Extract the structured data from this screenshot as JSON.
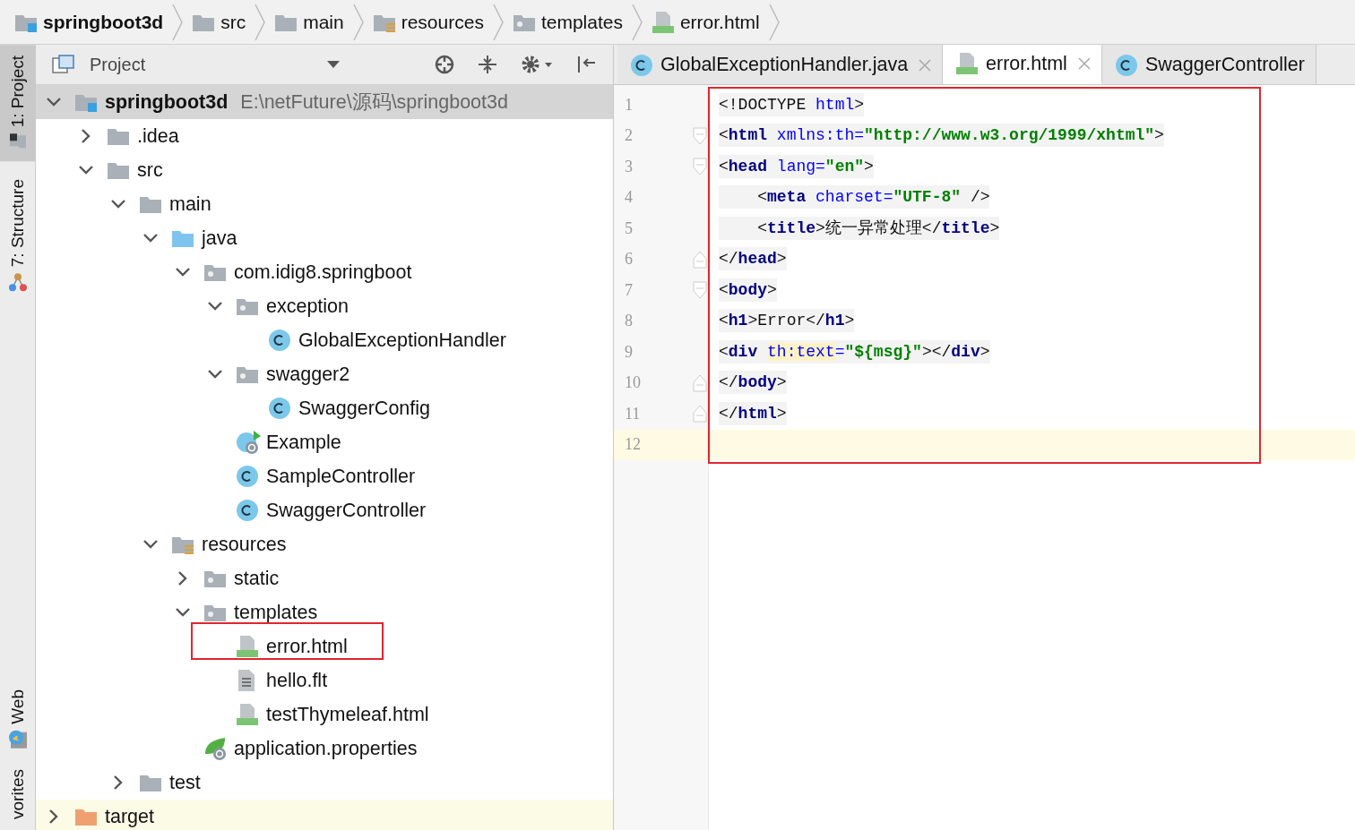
{
  "breadcrumbs": [
    {
      "label": "springboot3d",
      "kind": "module"
    },
    {
      "label": "src",
      "kind": "folder"
    },
    {
      "label": "main",
      "kind": "folder"
    },
    {
      "label": "resources",
      "kind": "resources-folder"
    },
    {
      "label": "templates",
      "kind": "resource-folder"
    },
    {
      "label": "error.html",
      "kind": "html"
    }
  ],
  "tool_strip": [
    {
      "label": "1: Project",
      "kind": "project",
      "selected": true
    },
    {
      "label": "7: Structure",
      "kind": "structure",
      "selected": false
    },
    {
      "label": "Web",
      "kind": "web",
      "selected": false
    },
    {
      "label": "vorites",
      "kind": "favorites",
      "selected": false
    }
  ],
  "project_panel": {
    "title": "Project",
    "tree": [
      {
        "label": "springboot3d",
        "path": "E:\\netFuture\\源码\\springboot3d",
        "kind": "module",
        "expanded": true,
        "selected": true,
        "highlighted": false,
        "children": [
          {
            "label": ".idea",
            "kind": "folder",
            "expanded": false,
            "selected": false,
            "highlighted": false
          },
          {
            "label": "src",
            "kind": "folder",
            "expanded": true,
            "selected": false,
            "highlighted": false,
            "children": [
              {
                "label": "main",
                "kind": "folder",
                "expanded": true,
                "selected": false,
                "highlighted": false,
                "children": [
                  {
                    "label": "java",
                    "kind": "source-folder",
                    "expanded": true,
                    "selected": false,
                    "highlighted": false,
                    "children": [
                      {
                        "label": "com.idig8.springboot",
                        "kind": "package",
                        "expanded": true,
                        "selected": false,
                        "highlighted": false,
                        "children": [
                          {
                            "label": "exception",
                            "kind": "package",
                            "expanded": true,
                            "selected": false,
                            "highlighted": false,
                            "children": [
                              {
                                "label": "GlobalExceptionHandler",
                                "kind": "class",
                                "selected": false,
                                "highlighted": false
                              }
                            ]
                          },
                          {
                            "label": "swagger2",
                            "kind": "package",
                            "expanded": true,
                            "selected": false,
                            "highlighted": false,
                            "children": [
                              {
                                "label": "SwaggerConfig",
                                "kind": "class",
                                "selected": false,
                                "highlighted": false
                              }
                            ]
                          },
                          {
                            "label": "Example",
                            "kind": "boot-class",
                            "selected": false,
                            "highlighted": false
                          },
                          {
                            "label": "SampleController",
                            "kind": "class",
                            "selected": false,
                            "highlighted": false
                          },
                          {
                            "label": "SwaggerController",
                            "kind": "class",
                            "selected": false,
                            "highlighted": false
                          }
                        ]
                      }
                    ]
                  },
                  {
                    "label": "resources",
                    "kind": "resources-folder",
                    "expanded": true,
                    "selected": false,
                    "highlighted": false,
                    "children": [
                      {
                        "label": "static",
                        "kind": "resource-folder",
                        "expanded": false,
                        "selected": false,
                        "highlighted": false
                      },
                      {
                        "label": "templates",
                        "kind": "resource-folder",
                        "expanded": true,
                        "selected": false,
                        "highlighted": false,
                        "children": [
                          {
                            "label": "error.html",
                            "kind": "html",
                            "selected": false,
                            "highlighted": true
                          },
                          {
                            "label": "hello.flt",
                            "kind": "text",
                            "selected": false,
                            "highlighted": false
                          },
                          {
                            "label": "testThymeleaf.html",
                            "kind": "html",
                            "selected": false,
                            "highlighted": false
                          }
                        ]
                      },
                      {
                        "label": "application.properties",
                        "kind": "spring-config",
                        "selected": false,
                        "highlighted": false
                      }
                    ]
                  }
                ]
              },
              {
                "label": "test",
                "kind": "folder",
                "expanded": false,
                "selected": false,
                "highlighted": false
              }
            ]
          }
        ]
      },
      {
        "label": "target",
        "kind": "excluded-folder",
        "expanded": false,
        "selected": false,
        "highlighted": false
      }
    ]
  },
  "editor": {
    "tabs": [
      {
        "label": "GlobalExceptionHandler.java",
        "kind": "class",
        "selected": false
      },
      {
        "label": "error.html",
        "kind": "html",
        "selected": true
      },
      {
        "label": "SwaggerController",
        "kind": "class",
        "selected": false
      }
    ],
    "highlighted": true,
    "lines": [
      {
        "number": "1",
        "kind": "plain",
        "current": false,
        "tokens": [
          {
            "kind": "punct",
            "text": "<!DOCTYPE "
          },
          {
            "kind": "attr",
            "text": "html"
          },
          {
            "kind": "punct",
            "text": ">"
          }
        ]
      },
      {
        "number": "2",
        "kind": "fold-start",
        "current": false,
        "tokens": [
          {
            "kind": "punct",
            "text": "<"
          },
          {
            "kind": "tag",
            "text": "html "
          },
          {
            "kind": "attr",
            "text": "xmlns:th="
          },
          {
            "kind": "value",
            "text": "\"http://www.w3.org/1999/xhtml\""
          },
          {
            "kind": "punct",
            "text": ">"
          }
        ]
      },
      {
        "number": "3",
        "kind": "fold-start",
        "current": false,
        "tokens": [
          {
            "kind": "punct",
            "text": "<"
          },
          {
            "kind": "tag",
            "text": "head "
          },
          {
            "kind": "attr",
            "text": "lang="
          },
          {
            "kind": "value",
            "text": "\"en\""
          },
          {
            "kind": "punct",
            "text": ">"
          }
        ]
      },
      {
        "number": "4",
        "kind": "plain",
        "current": false,
        "tokens": [
          {
            "kind": "punct",
            "text": "    <"
          },
          {
            "kind": "tag",
            "text": "meta "
          },
          {
            "kind": "attr",
            "text": "charset="
          },
          {
            "kind": "value",
            "text": "\"UTF-8\""
          },
          {
            "kind": "punct",
            "text": " />"
          }
        ]
      },
      {
        "number": "5",
        "kind": "plain",
        "current": false,
        "tokens": [
          {
            "kind": "punct",
            "text": "    <"
          },
          {
            "kind": "tag",
            "text": "title"
          },
          {
            "kind": "punct",
            "text": ">"
          },
          {
            "kind": "text",
            "text": "统一异常处理"
          },
          {
            "kind": "punct",
            "text": "</"
          },
          {
            "kind": "tag",
            "text": "title"
          },
          {
            "kind": "punct",
            "text": ">"
          }
        ]
      },
      {
        "number": "6",
        "kind": "fold-end",
        "current": false,
        "tokens": [
          {
            "kind": "punct",
            "text": "</"
          },
          {
            "kind": "tag",
            "text": "head"
          },
          {
            "kind": "punct",
            "text": ">"
          }
        ]
      },
      {
        "number": "7",
        "kind": "fold-start",
        "current": false,
        "tokens": [
          {
            "kind": "punct",
            "text": "<"
          },
          {
            "kind": "tag",
            "text": "body"
          },
          {
            "kind": "punct",
            "text": ">"
          }
        ]
      },
      {
        "number": "8",
        "kind": "plain",
        "current": false,
        "tokens": [
          {
            "kind": "punct",
            "text": "<"
          },
          {
            "kind": "tag",
            "text": "h1"
          },
          {
            "kind": "punct",
            "text": ">"
          },
          {
            "kind": "text",
            "text": "Error"
          },
          {
            "kind": "punct",
            "text": "</"
          },
          {
            "kind": "tag",
            "text": "h1"
          },
          {
            "kind": "punct",
            "text": ">"
          }
        ]
      },
      {
        "number": "9",
        "kind": "plain",
        "current": false,
        "tokens": [
          {
            "kind": "punct",
            "text": "<"
          },
          {
            "kind": "tag",
            "text": "div "
          },
          {
            "kind": "attr-warn",
            "text": "th:text"
          },
          {
            "kind": "attr",
            "text": "="
          },
          {
            "kind": "value",
            "text": "\"${msg}\""
          },
          {
            "kind": "punct",
            "text": "></"
          },
          {
            "kind": "tag",
            "text": "div"
          },
          {
            "kind": "punct",
            "text": ">"
          }
        ]
      },
      {
        "number": "10",
        "kind": "fold-end",
        "current": false,
        "tokens": [
          {
            "kind": "punct",
            "text": "</"
          },
          {
            "kind": "tag",
            "text": "body"
          },
          {
            "kind": "punct",
            "text": ">"
          }
        ]
      },
      {
        "number": "11",
        "kind": "fold-end",
        "current": false,
        "tokens": [
          {
            "kind": "punct",
            "text": "</"
          },
          {
            "kind": "tag",
            "text": "html"
          },
          {
            "kind": "punct",
            "text": ">"
          }
        ]
      },
      {
        "number": "12",
        "kind": "plain",
        "current": true
      }
    ]
  }
}
